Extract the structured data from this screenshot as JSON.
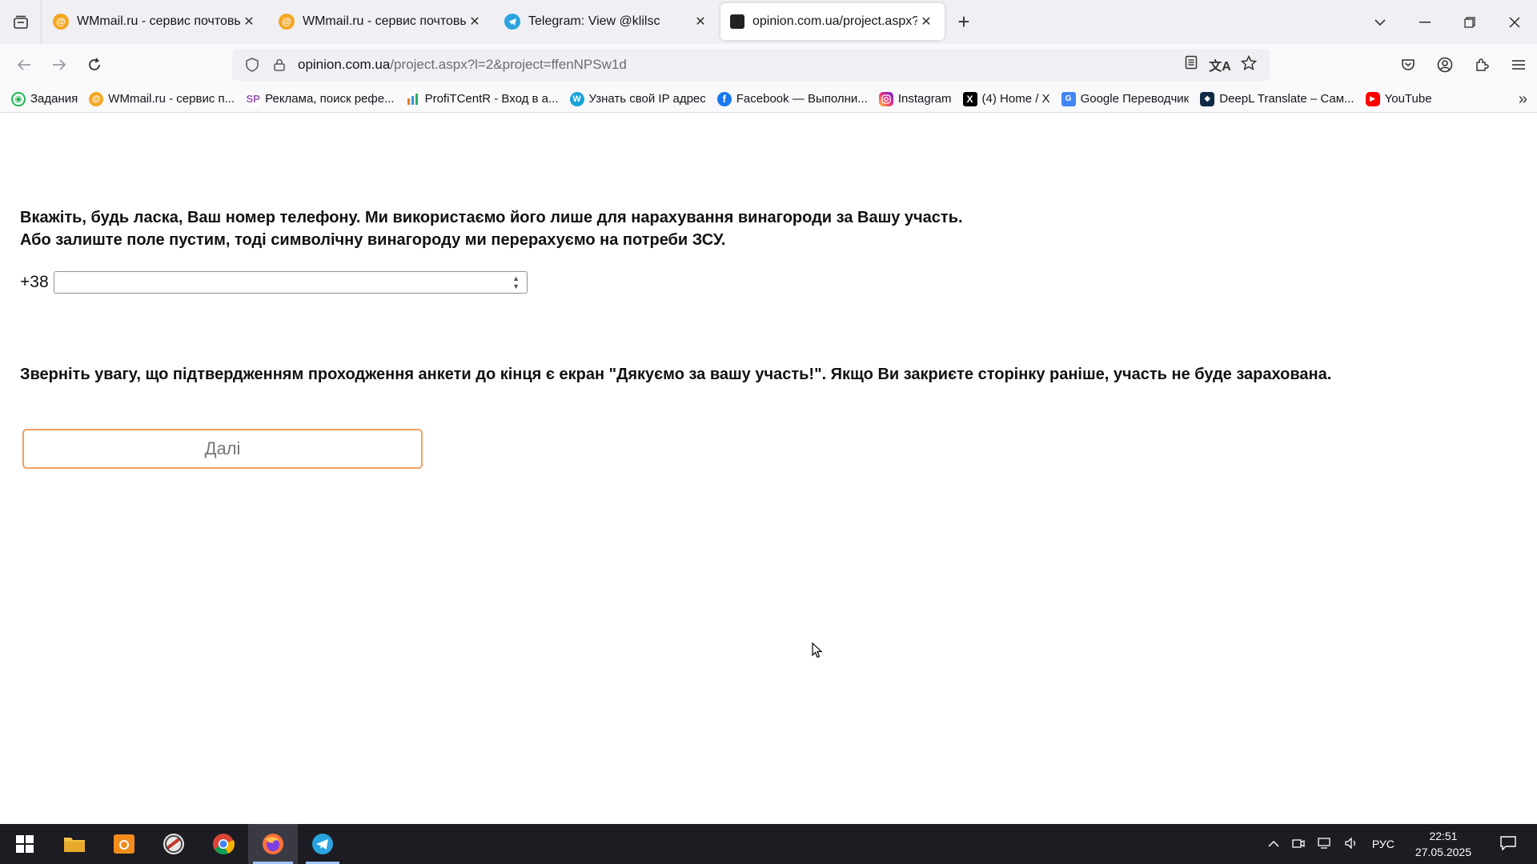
{
  "browser": {
    "tabs": [
      {
        "title": "WMmail.ru - сервис почтовых",
        "icon": "wmmail-icon"
      },
      {
        "title": "WMmail.ru - сервис почтовых",
        "icon": "wmmail-icon"
      },
      {
        "title": "Telegram: View @klilsc",
        "icon": "telegram-icon"
      },
      {
        "title": "opinion.com.ua/project.aspx?l=",
        "icon": "opinion-icon",
        "active": true
      }
    ],
    "url_domain": "opinion.com.ua",
    "url_rest": "/project.aspx?l=2&project=ffenNPSw1d"
  },
  "bookmarks": [
    {
      "label": "Задания"
    },
    {
      "label": "WMmail.ru - сервис п..."
    },
    {
      "label": "Реклама, поиск рефе..."
    },
    {
      "label": "ProfiTCentR - Вход в а..."
    },
    {
      "label": "Узнать свой IP адрес"
    },
    {
      "label": "Facebook — Выполни..."
    },
    {
      "label": "Instagram"
    },
    {
      "label": "(4) Home / X"
    },
    {
      "label": "Google Переводчик"
    },
    {
      "label": "DeepL Translate – Сам..."
    },
    {
      "label": "YouTube"
    }
  ],
  "survey": {
    "question_line1": "Вкажіть, будь ласка, Ваш номер телефону. Ми використаємо його лише для нарахування винагороди за Вашу участь.",
    "question_line2": "Або залиште поле пустим, тоді символічну винагороду ми перерахуємо на потреби ЗСУ.",
    "phone_prefix": "+38",
    "phone_value": "",
    "notice": "Зверніть увагу, що підтвердженням проходження анкети до кінця є екран \"Дякуємо за вашу участь!\". Якщо Ви закриєте сторінку раніше, участь не буде зарахована.",
    "next_label": "Далі"
  },
  "taskbar": {
    "language": "РУС",
    "time": "22:51",
    "date": "27.05.2025"
  },
  "colors": {
    "button_border": "#f0a060",
    "taskbar_bg": "#1c1c22"
  }
}
